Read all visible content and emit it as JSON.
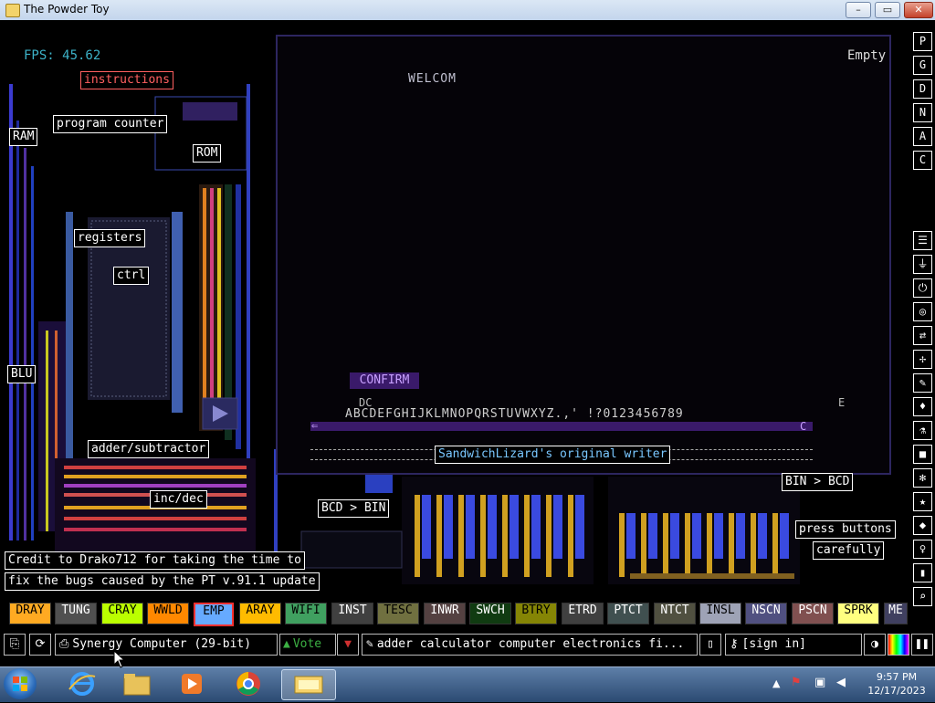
{
  "window": {
    "title": "The Powder Toy",
    "min": "–",
    "max": "▭",
    "close": "✕"
  },
  "hud": {
    "fps": "FPS: 45.62",
    "empty": "Empty"
  },
  "labels": {
    "instructions": "instructions",
    "program_counter": "program counter",
    "ram": "RAM",
    "rom": "ROM",
    "registers": "registers",
    "ctrl": "ctrl",
    "blu": "BLU",
    "adder": "adder/subtractor",
    "incdec": "inc/dec",
    "bcd_bin": "BCD > BIN",
    "bin_bcd": "BIN > BCD",
    "press1": "press buttons",
    "press2": "carefully",
    "credit1": "Credit to Drako712 for taking the time to",
    "credit2": "fix the bugs caused by the PT v.91.1 update"
  },
  "screen": {
    "welcome": "WELCOM",
    "confirm": "CONFIRM",
    "dc": "DC",
    "alphabet": "ABCDEFGHIJKLMNOPQRSTUVWXYZ.,' !?0123456789",
    "e": "E",
    "c": "C",
    "left_arrow": "⇐",
    "writer": "SandwichLizard's original writer"
  },
  "right_toolbar": {
    "top": [
      "P",
      "G",
      "D",
      "N",
      "A",
      "C"
    ],
    "icons": [
      "layers-icon",
      "plug-icon",
      "power-icon",
      "pressure-icon",
      "arrows-icon",
      "spray-icon",
      "pen-icon",
      "drop-icon",
      "flask-icon",
      "square-icon",
      "gear-icon",
      "star-icon",
      "sensor-icon",
      "bulb-icon",
      "bookmark-icon",
      "magnifier-icon"
    ]
  },
  "elements": [
    {
      "name": "DRAY",
      "color": "#ffaa22"
    },
    {
      "name": "TUNG",
      "color": "#505050",
      "text": "#ffffff"
    },
    {
      "name": "CRAY",
      "color": "#bbff00"
    },
    {
      "name": "WWLD",
      "color": "#ff8800"
    },
    {
      "name": "EMP",
      "color": "#66aaff",
      "selected": true
    },
    {
      "name": "ARAY",
      "color": "#ffbb00"
    },
    {
      "name": "WIFI",
      "color": "#40a060"
    },
    {
      "name": "INST",
      "color": "#404040",
      "text": "#ffffff"
    },
    {
      "name": "TESC",
      "color": "#707040"
    },
    {
      "name": "INWR",
      "color": "#544141",
      "text": "#ffffff"
    },
    {
      "name": "SWCH",
      "color": "#103b11",
      "text": "#ffffff"
    },
    {
      "name": "BTRY",
      "color": "#858505"
    },
    {
      "name": "ETRD",
      "color": "#404040",
      "text": "#ffffff"
    },
    {
      "name": "PTCT",
      "color": "#405050",
      "text": "#ffffff"
    },
    {
      "name": "NTCT",
      "color": "#505040",
      "text": "#ffffff"
    },
    {
      "name": "INSL",
      "color": "#9ea3b6"
    },
    {
      "name": "NSCN",
      "color": "#505080",
      "text": "#ffffff"
    },
    {
      "name": "PSCN",
      "color": "#805050",
      "text": "#ffffff"
    },
    {
      "name": "SPRK",
      "color": "#ffff80"
    },
    {
      "name": "ME",
      "color": "#404060",
      "text": "#ffffff"
    }
  ],
  "bottombar": {
    "save_name": "Synergy Computer (29-bit)",
    "vote": "Vote",
    "tags": "adder calculator computer electronics fi...",
    "sign_in": "[sign in]"
  },
  "taskbar": {
    "time": "9:57 PM",
    "date": "12/17/2023"
  },
  "colors": {
    "accent": "#3db2c8",
    "element_selected_border": "#ff3030"
  }
}
